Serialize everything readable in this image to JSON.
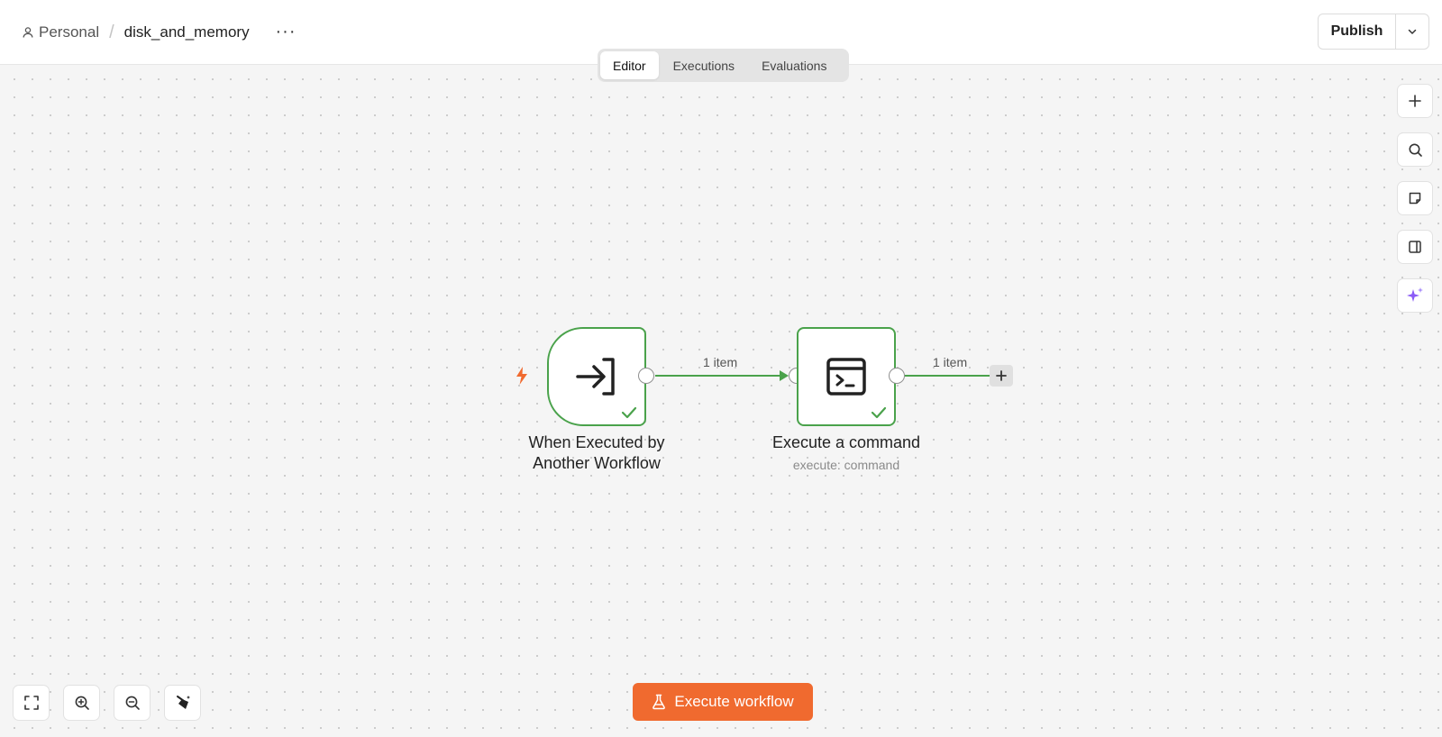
{
  "header": {
    "project": "Personal",
    "separator": "/",
    "workflow_name": "disk_and_memory",
    "more_label": "···",
    "publish_label": "Publish"
  },
  "tabs": [
    {
      "label": "Editor",
      "active": true
    },
    {
      "label": "Executions",
      "active": false
    },
    {
      "label": "Evaluations",
      "active": false
    }
  ],
  "side_tools": [
    "plus-icon",
    "search-icon",
    "sticky-note-icon",
    "panel-icon",
    "ai-sparkle-icon"
  ],
  "bottom_tools": [
    "fit-view-icon",
    "zoom-in-icon",
    "zoom-out-icon",
    "clean-up-icon"
  ],
  "nodes": [
    {
      "title_line1": "When Executed by",
      "title_line2": "Another Workflow",
      "icon": "sign-in-arrow-icon",
      "status": "success"
    },
    {
      "title": "Execute a command",
      "subtitle": "execute: command",
      "icon": "terminal-icon",
      "status": "success"
    }
  ],
  "connections": [
    {
      "label": "1 item"
    },
    {
      "label": "1 item"
    }
  ],
  "execute_button": {
    "label": "Execute workflow"
  },
  "colors": {
    "accent": "#f06a2f",
    "success": "#4aa24b",
    "ai_purple": "#8b5cf6",
    "trigger_bolt": "#f06a2f"
  }
}
